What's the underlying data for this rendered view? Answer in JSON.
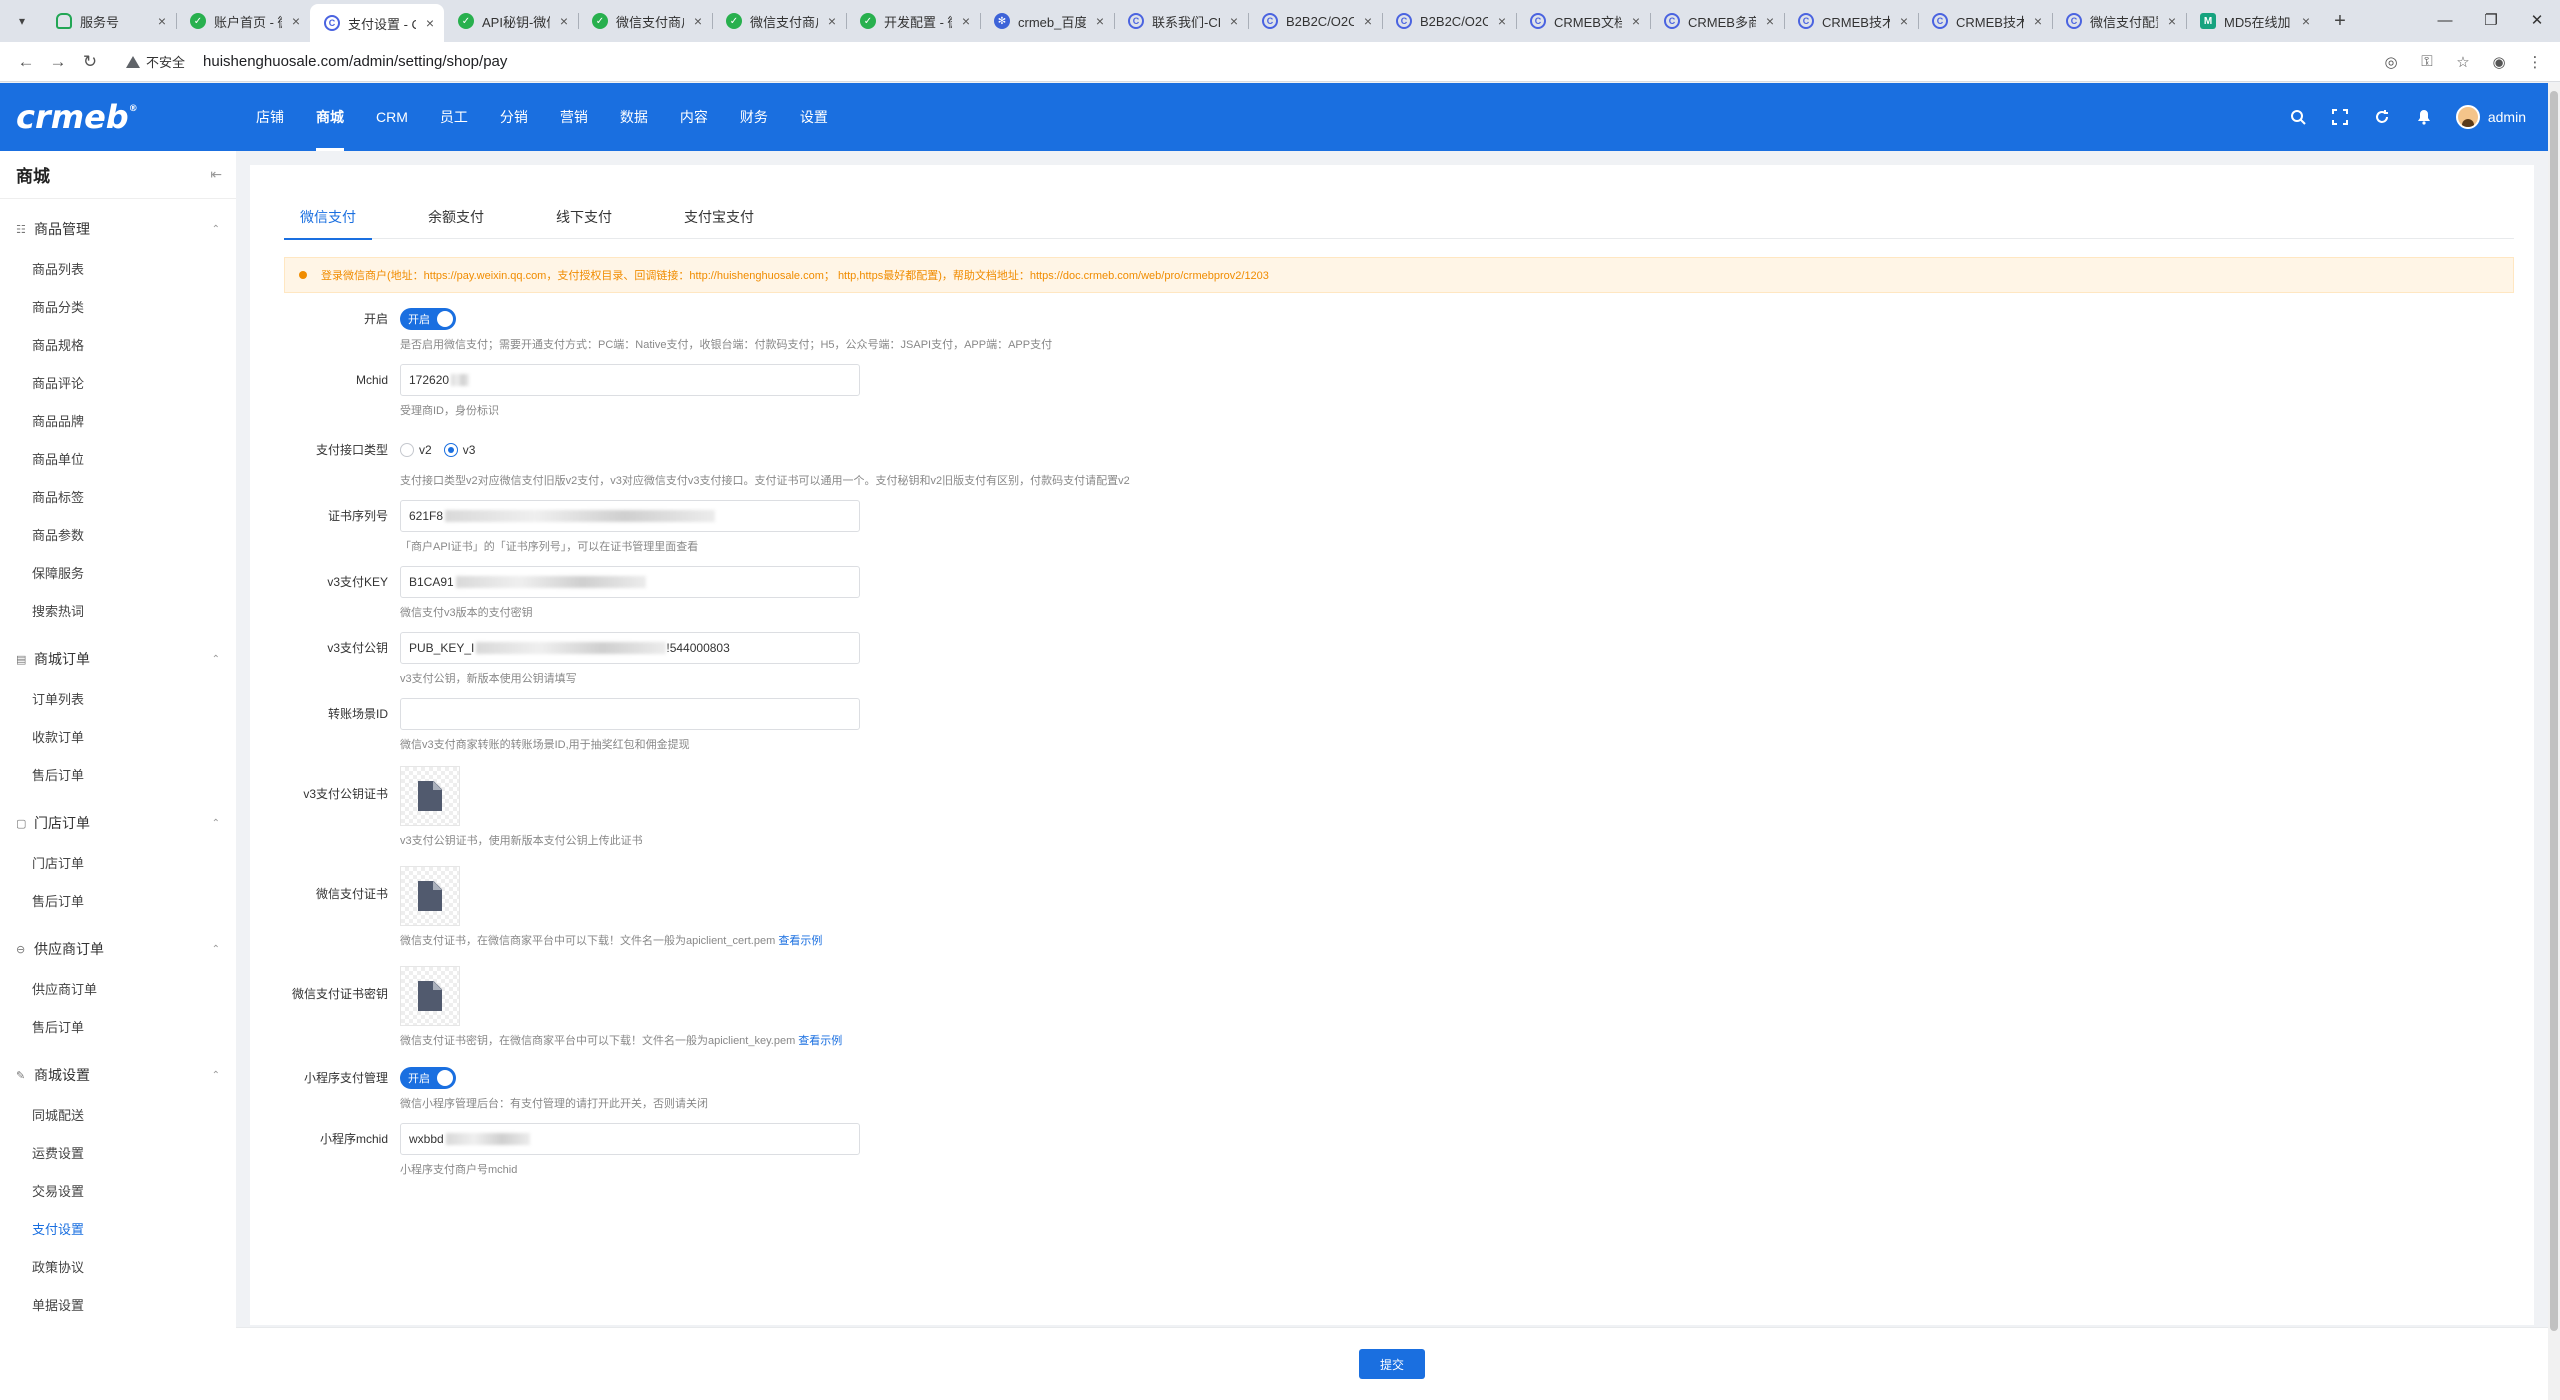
{
  "browser": {
    "tabs": [
      {
        "title": "服务号",
        "favicon": "cloud-icon",
        "active": false
      },
      {
        "title": "账户首页 - 微",
        "favicon": "wechat-pay-icon",
        "active": false
      },
      {
        "title": "支付设置 - C",
        "favicon": "crmeb-icon",
        "active": true
      },
      {
        "title": "API秘钥-微信",
        "favicon": "wechat-pay-icon",
        "active": false
      },
      {
        "title": "微信支付商户",
        "favicon": "wechat-pay-icon",
        "active": false
      },
      {
        "title": "微信支付商户",
        "favicon": "wechat-pay-icon",
        "active": false
      },
      {
        "title": "开发配置 - 微",
        "favicon": "wechat-pay-icon",
        "active": false
      },
      {
        "title": "crmeb_百度",
        "favicon": "gear-icon",
        "active": false
      },
      {
        "title": "联系我们-CR",
        "favicon": "crmeb-icon",
        "active": false
      },
      {
        "title": "B2B2C/O2O",
        "favicon": "crmeb-icon",
        "active": false
      },
      {
        "title": "B2B2C/O2O",
        "favicon": "crmeb-icon",
        "active": false
      },
      {
        "title": "CRMEB文档",
        "favicon": "crmeb-icon",
        "active": false
      },
      {
        "title": "CRMEB多商",
        "favicon": "crmeb-icon",
        "active": false
      },
      {
        "title": "CRMEB技术",
        "favicon": "crmeb-icon",
        "active": false
      },
      {
        "title": "CRMEB技术",
        "favicon": "crmeb-icon",
        "active": false
      },
      {
        "title": "微信支付配置",
        "favicon": "crmeb-icon",
        "active": false
      },
      {
        "title": "MD5在线加",
        "favicon": "md5-icon",
        "active": false
      }
    ],
    "security_label": "不安全",
    "url": "huishenghuosale.com/admin/setting/shop/pay"
  },
  "header": {
    "logo": "crmeb",
    "nav": [
      "店铺",
      "商城",
      "CRM",
      "员工",
      "分销",
      "营销",
      "数据",
      "内容",
      "财务",
      "设置"
    ],
    "active_nav": "商城",
    "user_name": "admin"
  },
  "sidebar": {
    "title": "商城",
    "groups": [
      {
        "label": "商品管理",
        "icon": "product-icon",
        "items": [
          "商品列表",
          "商品分类",
          "商品规格",
          "商品评论",
          "商品品牌",
          "商品单位",
          "商品标签",
          "商品参数",
          "保障服务",
          "搜索热词"
        ]
      },
      {
        "label": "商城订单",
        "icon": "order-icon",
        "items": [
          "订单列表",
          "收款订单",
          "售后订单"
        ]
      },
      {
        "label": "门店订单",
        "icon": "store-icon",
        "items": [
          "门店订单",
          "售后订单"
        ]
      },
      {
        "label": "供应商订单",
        "icon": "supplier-icon",
        "items": [
          "供应商订单",
          "售后订单"
        ]
      },
      {
        "label": "商城设置",
        "icon": "settings-icon",
        "items": [
          "同城配送",
          "运费设置",
          "交易设置",
          "支付设置",
          "政策协议",
          "单据设置"
        ]
      }
    ],
    "active_item": "支付设置"
  },
  "content": {
    "tabs": [
      "微信支付",
      "余额支付",
      "线下支付",
      "支付宝支付"
    ],
    "active_tab": "微信支付",
    "alert": "登录微信商户(地址：https://pay.weixin.qq.com，支付授权目录、回调链接：http://huishenghuosale.com；  http,https最好都配置)，帮助文档地址：https://doc.crmeb.com/web/pro/crmebprov2/1203",
    "fields": {
      "enable": {
        "label": "开启",
        "switch_text": "开启",
        "hint": "是否启用微信支付；需要开通支付方式：PC端：Native支付，收银台端：付款码支付；H5，公众号端：JSAPI支付，APP端：APP支付"
      },
      "mchid": {
        "label": "Mchid",
        "value": "172620",
        "hint": "受理商ID，身份标识"
      },
      "api_type": {
        "label": "支付接口类型",
        "options": [
          "v2",
          "v3"
        ],
        "selected": "v3",
        "hint": "支付接口类型v2对应微信支付旧版v2支付，v3对应微信支付v3支付接口。支付证书可以通用一个。支付秘钥和v2旧版支付有区别，付款码支付请配置v2"
      },
      "serial_no": {
        "label": "证书序列号",
        "value": "621F8",
        "hint": "「商户API证书」的「证书序列号」，可以在证书管理里面查看"
      },
      "v3_key": {
        "label": "v3支付KEY",
        "value": "B1CA91",
        "hint": "微信支付v3版本的支付密钥"
      },
      "v3_pubkey": {
        "label": "v3支付公钥",
        "value_prefix": "PUB_KEY_I",
        "value_suffix": "!544000803",
        "hint": "v3支付公钥，新版本使用公钥请填写"
      },
      "transfer_scene": {
        "label": "转账场景ID",
        "value": "",
        "hint": "微信v3支付商家转账的转账场景ID,用于抽奖红包和佣金提现"
      },
      "v3_pubkey_cert": {
        "label": "v3支付公钥证书",
        "hint": "v3支付公钥证书，使用新版本支付公钥上传此证书"
      },
      "cert": {
        "label": "微信支付证书",
        "hint": "微信支付证书，在微信商家平台中可以下载！文件名一般为apiclient_cert.pem",
        "link": "查看示例"
      },
      "cert_key": {
        "label": "微信支付证书密钥",
        "hint": "微信支付证书密钥，在微信商家平台中可以下载！文件名一般为apiclient_key.pem",
        "link": "查看示例"
      },
      "mini_manage": {
        "label": "小程序支付管理",
        "switch_text": "开启",
        "hint": "微信小程序管理后台：有支付管理的请打开此开关，否则请关闭"
      },
      "mini_mchid": {
        "label": "小程序mchid",
        "value": "wxbbd",
        "hint": "小程序支付商户号mchid"
      }
    },
    "submit_label": "提交"
  },
  "colors": {
    "primary": "#1a6fe0",
    "alert_text": "#f08c00",
    "alert_bg": "#fff5e6"
  }
}
